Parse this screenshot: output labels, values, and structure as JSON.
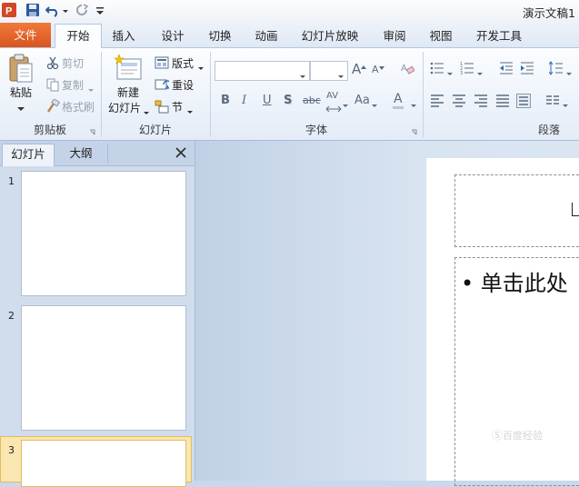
{
  "window": {
    "title": "演示文稿1"
  },
  "tabs": [
    {
      "label": "文件"
    },
    {
      "label": "开始"
    },
    {
      "label": "插入"
    },
    {
      "label": "设计"
    },
    {
      "label": "切换"
    },
    {
      "label": "动画"
    },
    {
      "label": "幻灯片放映"
    },
    {
      "label": "审阅"
    },
    {
      "label": "视图"
    },
    {
      "label": "开发工具"
    }
  ],
  "ribbon": {
    "clipboard": {
      "paste": "粘贴",
      "cut": "剪切",
      "copy": "复制",
      "format_painter": "格式刷",
      "group": "剪贴板"
    },
    "slides": {
      "new_line1": "新建",
      "new_line2": "幻灯片",
      "layout": "版式",
      "reset": "重设",
      "section": "节",
      "group": "幻灯片"
    },
    "font": {
      "bold": "B",
      "italic": "I",
      "underline": "U",
      "shadow": "S",
      "strike": "abc",
      "spacing": "AV",
      "case": "Aa",
      "color": "A",
      "grow": "A",
      "shrink": "A",
      "group": "字体"
    },
    "paragraph": {
      "group": "段落"
    }
  },
  "panel": {
    "tabs": [
      {
        "label": "幻灯片"
      },
      {
        "label": "大纲"
      }
    ],
    "slides": [
      {
        "number": "1"
      },
      {
        "number": "2"
      },
      {
        "number": "3"
      }
    ]
  },
  "slide": {
    "body_text": "单击此处"
  },
  "watermark": "百度经验"
}
